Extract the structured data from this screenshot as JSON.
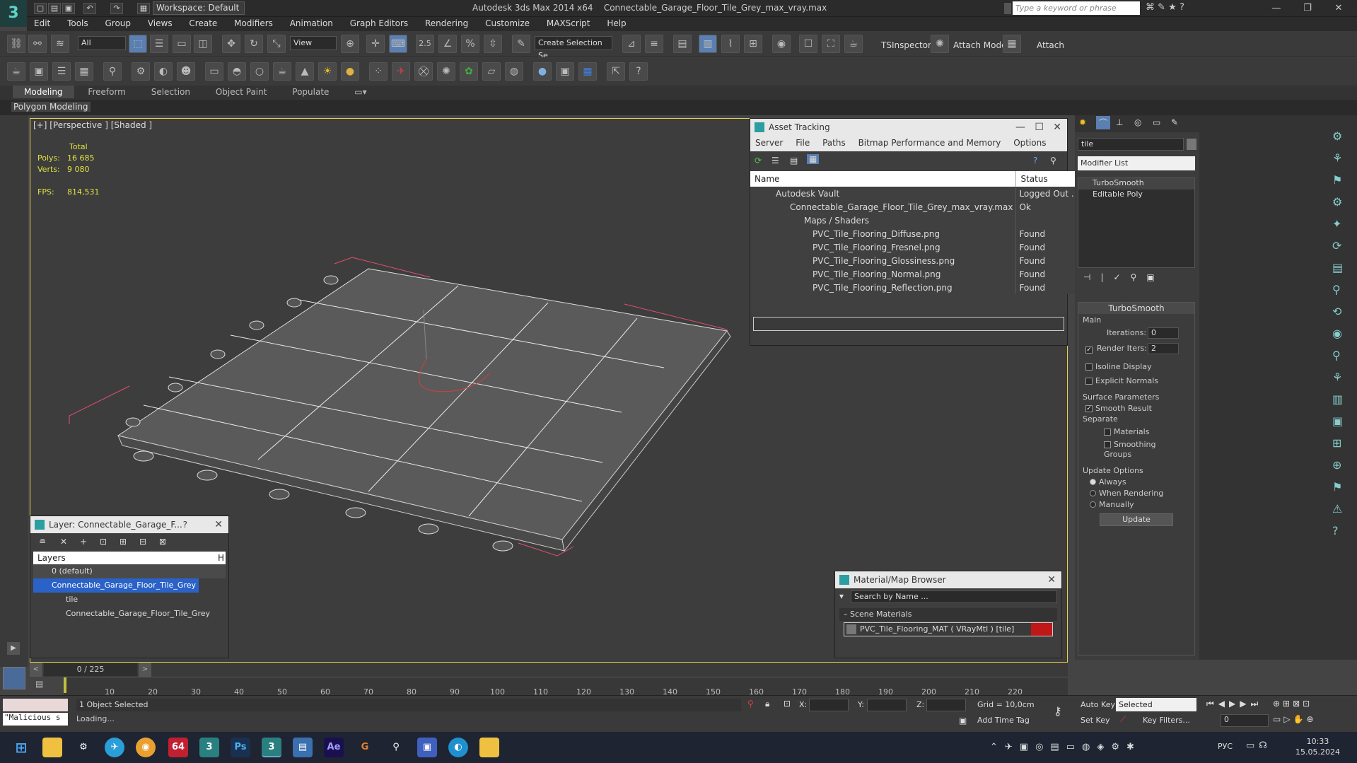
{
  "app": {
    "title": "Autodesk 3ds Max  2014 x64",
    "file": "Connectable_Garage_Floor_Tile_Grey_max_vray.max",
    "workspace": "Workspace: Default",
    "search_placeholder": "Type a keyword or phrase"
  },
  "menu": [
    "Edit",
    "Tools",
    "Group",
    "Views",
    "Create",
    "Modifiers",
    "Animation",
    "Graph Editors",
    "Rendering",
    "Customize",
    "MAXScript",
    "Help"
  ],
  "toolbar": {
    "selection_filter": "All",
    "ref_coord": "View",
    "named_selection": "Create Selection Se",
    "tsinspector": "TSInspector",
    "attach_mode": "Attach Mode",
    "attach": "Attach",
    "snaps": "2.5"
  },
  "ribbon": {
    "tabs": [
      "Modeling",
      "Freeform",
      "Selection",
      "Object Paint",
      "Populate"
    ],
    "sub": "Polygon Modeling"
  },
  "viewport": {
    "label": "[+] [Perspective ] [Shaded ]",
    "total": "Total",
    "polys_label": "Polys:",
    "polys": "16 685",
    "verts_label": "Verts:",
    "verts": "9 080",
    "fps_label": "FPS:",
    "fps": "814,531"
  },
  "asset_tracking": {
    "title": "Asset Tracking",
    "menu": [
      "Server",
      "File",
      "Paths",
      "Bitmap Performance and Memory",
      "Options"
    ],
    "col_name": "Name",
    "col_status": "Status",
    "rows": [
      {
        "name": "Autodesk Vault",
        "status": "Logged Out ..."
      },
      {
        "name": "Connectable_Garage_Floor_Tile_Grey_max_vray.max",
        "status": "Ok"
      },
      {
        "name": "Maps / Shaders",
        "status": ""
      },
      {
        "name": "PVC_Tile_Flooring_Diffuse.png",
        "status": "Found"
      },
      {
        "name": "PVC_Tile_Flooring_Fresnel.png",
        "status": "Found"
      },
      {
        "name": "PVC_Tile_Flooring_Glossiness.png",
        "status": "Found"
      },
      {
        "name": "PVC_Tile_Flooring_Normal.png",
        "status": "Found"
      },
      {
        "name": "PVC_Tile_Flooring_Reflection.png",
        "status": "Found"
      }
    ]
  },
  "layer": {
    "title": "Layer: Connectable_Garage_F...",
    "help": "?",
    "col": "Layers",
    "col_h": "H",
    "rows": [
      "0 (default)",
      "Connectable_Garage_Floor_Tile_Grey",
      "tile",
      "Connectable_Garage_Floor_Tile_Grey"
    ]
  },
  "material": {
    "title": "Material/Map Browser",
    "search": "Search by Name ...",
    "section": "Scene Materials",
    "item": "PVC_Tile_Flooring_MAT  ( VRayMtl )  [tile]"
  },
  "modify": {
    "name": "tile",
    "modifier_list": "Modifier List",
    "stack": [
      "TurboSmooth",
      "Editable Poly"
    ],
    "rollout": "TurboSmooth",
    "main": "Main",
    "iterations_label": "Iterations:",
    "iterations": "0",
    "render_iters_label": "Render Iters:",
    "render_iters": "2",
    "isoline": "Isoline Display",
    "explicit": "Explicit Normals",
    "surface": "Surface Parameters",
    "smooth_result": "Smooth Result",
    "separate": "Separate",
    "materials": "Materials",
    "smoothing_groups": "Smoothing Groups",
    "update_options": "Update Options",
    "always": "Always",
    "when_rendering": "When Rendering",
    "manually": "Manually",
    "update": "Update"
  },
  "timeline": {
    "frame": "0 / 225",
    "ticks": [
      "10",
      "20",
      "30",
      "40",
      "50",
      "60",
      "70",
      "80",
      "90",
      "100",
      "110",
      "120",
      "130",
      "140",
      "150",
      "160",
      "170",
      "180",
      "190",
      "200",
      "210",
      "220"
    ]
  },
  "status": {
    "script": "\"Malicious s",
    "selected": "1 Object Selected",
    "loading": "Loading...",
    "x": "X:",
    "y": "Y:",
    "z": "Z:",
    "grid": "Grid = 10,0cm",
    "add_time_tag": "Add Time Tag",
    "auto_key": "Auto Key",
    "set_key": "Set Key",
    "selected_dd": "Selected",
    "key_filters": "Key Filters...",
    "frame_field": "0"
  },
  "taskbar": {
    "lang": "РУС",
    "time": "10:33",
    "date": "15.05.2024",
    "badge": "64",
    "ps": "Ps",
    "ae": "Ae"
  }
}
